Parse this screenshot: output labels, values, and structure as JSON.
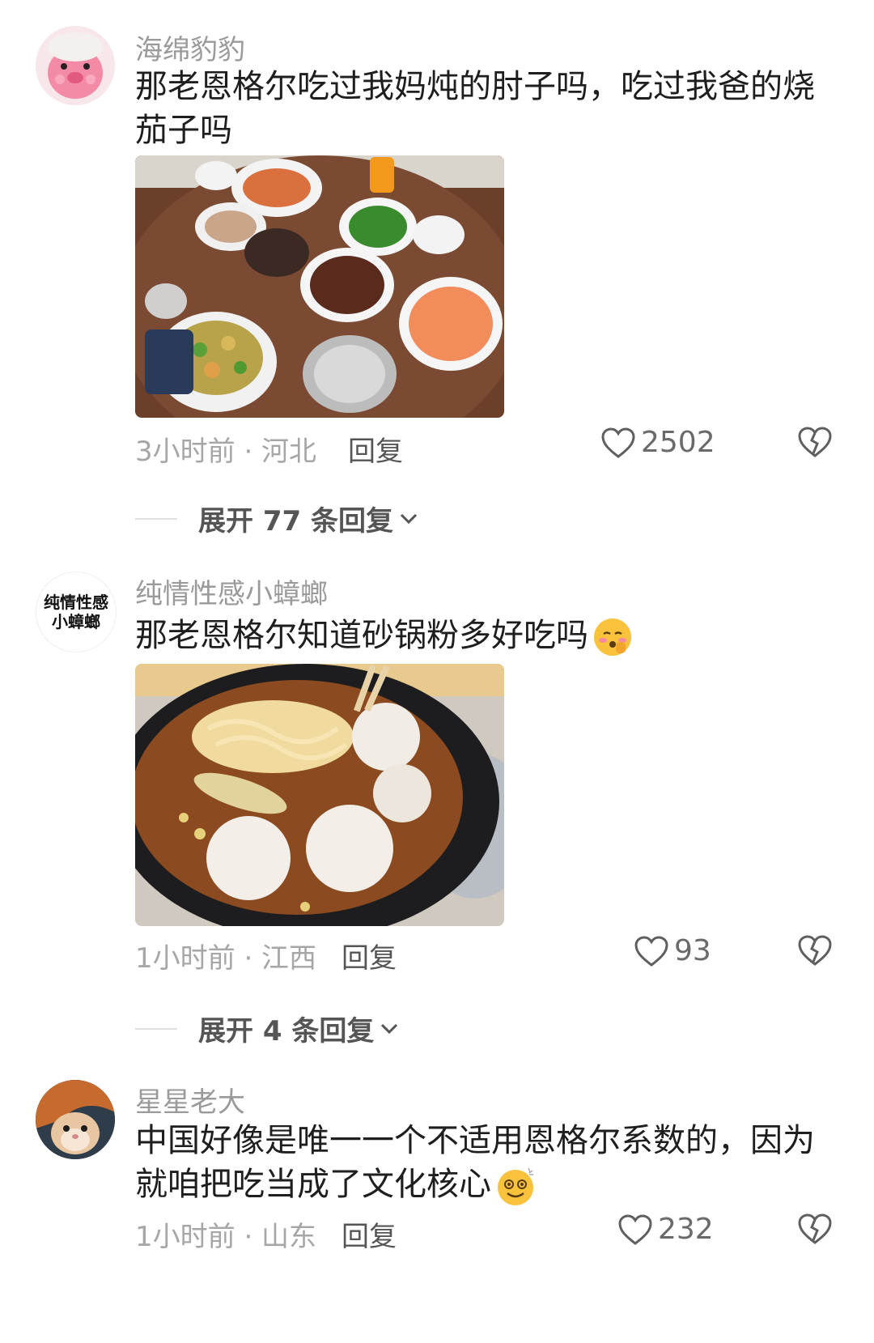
{
  "comments": [
    {
      "username": "海绵豹豹",
      "text": "那老恩格尔吃过我妈炖的肘子吗，吃过我爸的烧茄子吗",
      "time_location": "3小时前 · 河北",
      "reply_label": "回复",
      "likes": "2502",
      "expand_label": "展开 77 条回复"
    },
    {
      "username": "纯情性感小蟑螂",
      "avatar_text": "纯情性感小蟑螂",
      "text": "那老恩格尔知道砂锅粉多好吃吗",
      "time_location": "1小时前 · 江西",
      "reply_label": "回复",
      "likes": "93",
      "expand_label": "展开 4 条回复"
    },
    {
      "username": "星星老大",
      "text": "中国好像是唯一一个不适用恩格尔系数的，因为就咱把吃当成了文化核心",
      "time_location": "1小时前 · 山东",
      "reply_label": "回复",
      "likes": "232"
    }
  ],
  "icons": {
    "like": "heart-icon",
    "dislike": "broken-heart-icon",
    "expand": "chevron-down-icon"
  }
}
